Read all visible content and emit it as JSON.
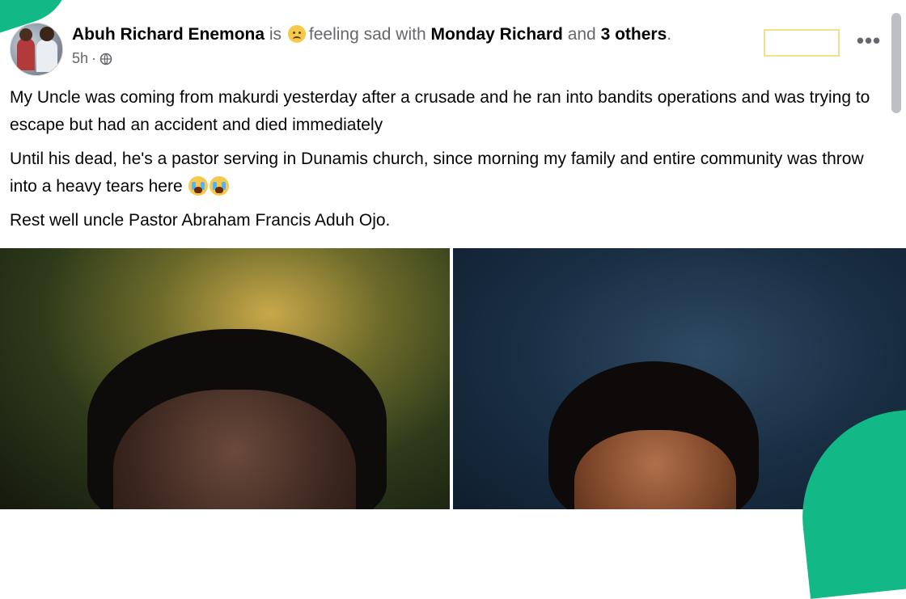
{
  "post": {
    "author": "Abuh Richard Enemona",
    "is_text": "is",
    "feeling": "feeling sad with",
    "tagged": "Monday Richard",
    "and_text": "and",
    "others": "3 others",
    "period": ".",
    "time": "5h",
    "dot": "·",
    "paragraphs": [
      "My Uncle was coming from makurdi yesterday after a crusade and he ran into bandits operations and was trying to escape but had an accident and died immediately",
      "Until his dead, he's a pastor serving in Dunamis church, since morning my family and entire community was throw into a heavy tears here",
      "Rest well uncle Pastor Abraham Francis Aduh Ojo."
    ],
    "more_label": "•••"
  },
  "icons": {
    "feeling": "sad-face-emoji-icon",
    "privacy": "globe-icon",
    "crying": "loudly-crying-emoji-icon"
  },
  "colors": {
    "accent_corner": "#12b886",
    "text_primary": "#050505",
    "text_secondary": "#65676b"
  }
}
